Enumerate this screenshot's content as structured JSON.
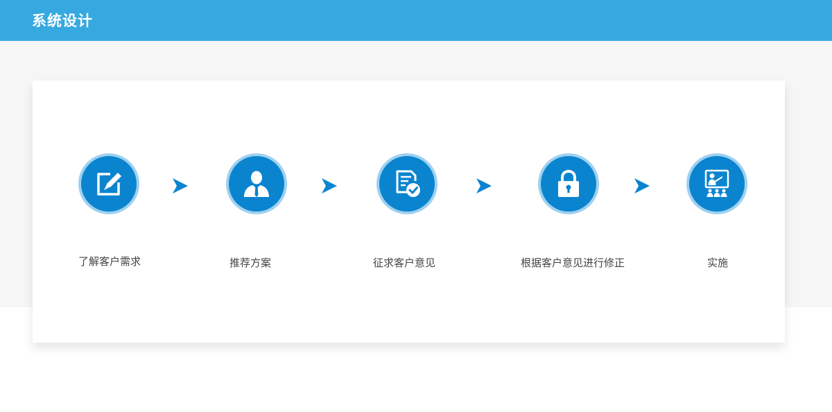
{
  "header": {
    "title": "系统设计"
  },
  "colors": {
    "header_bg": "#36a9e0",
    "icon_fill": "#0b84cf",
    "icon_ring": "#9ed1ef"
  },
  "steps": [
    {
      "label": "了解客户需求",
      "icon": "edit-icon"
    },
    {
      "label": "推荐方案",
      "icon": "person-icon"
    },
    {
      "label": "征求客户意见",
      "icon": "document-check-icon"
    },
    {
      "label": "根据客户意见进行修正",
      "icon": "lock-icon"
    },
    {
      "label": "实施",
      "icon": "presentation-icon"
    }
  ]
}
